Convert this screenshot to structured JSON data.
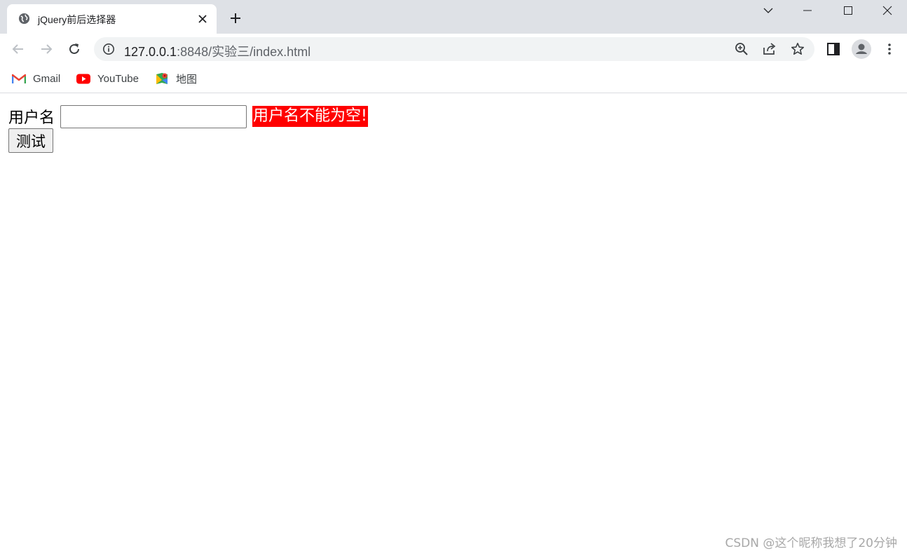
{
  "browser": {
    "tab": {
      "title": "jQuery前后选择器"
    },
    "address_bar": {
      "host": "127.0.0.1",
      "path": ":8848/实验三/index.html"
    },
    "bookmarks": [
      {
        "label": "Gmail",
        "icon": "gmail-icon"
      },
      {
        "label": "YouTube",
        "icon": "youtube-icon"
      },
      {
        "label": "地图",
        "icon": "maps-icon"
      }
    ]
  },
  "page": {
    "field_label": "用户名",
    "input_value": "",
    "error_message": "用户名不能为空!",
    "button_label": "测试"
  },
  "watermark": "CSDN @这个昵称我想了20分钟",
  "colors": {
    "error_bg": "#ff0000",
    "error_text": "#ffffff",
    "tabbar_bg": "#dee1e6",
    "omnibox_bg": "#f1f3f4"
  }
}
